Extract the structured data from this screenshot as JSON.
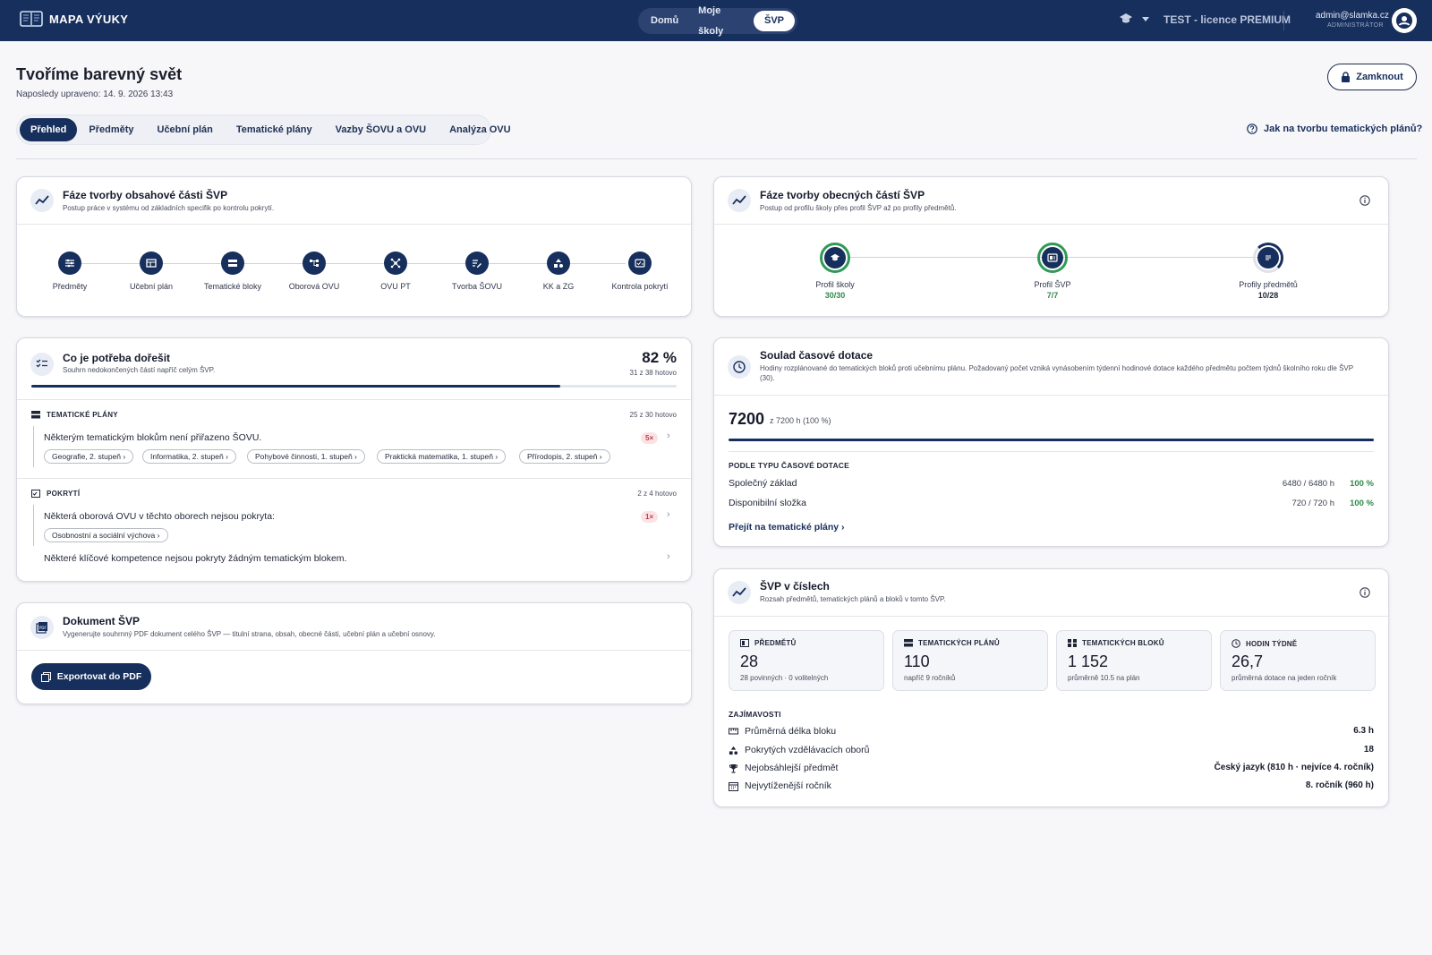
{
  "topbar": {
    "logo_text": "MAPA VÝUKY",
    "nav": [
      {
        "label": "Domů"
      },
      {
        "label": "Moje školy"
      },
      {
        "label": "ŠVP"
      }
    ],
    "license": "TEST - licence PREMIUM",
    "user_email": "admin@slamka.cz",
    "user_role": "ADMINISTRÁTOR"
  },
  "page": {
    "title": "Tvoříme barevný svět",
    "subtitle": "Naposledy upraveno: 14. 9. 2026 13:43",
    "lock_label": "Zamknout",
    "help_label": "Jak na tvorbu tematických plánů?"
  },
  "tabs": [
    {
      "label": "Přehled"
    },
    {
      "label": "Předměty"
    },
    {
      "label": "Učební plán"
    },
    {
      "label": "Tematické plány"
    },
    {
      "label": "Vazby ŠOVU a OVU"
    },
    {
      "label": "Analýza OVU"
    }
  ],
  "content_phases": {
    "title": "Fáze tvorby obsahové části ŠVP",
    "subtitle": "Postup práce v systému od základních specifik po kontrolu pokrytí.",
    "steps": [
      {
        "label": "Předměty"
      },
      {
        "label": "Učební plán"
      },
      {
        "label": "Tematické bloky"
      },
      {
        "label": "Oborová OVU"
      },
      {
        "label": "OVU PT"
      },
      {
        "label": "Tvorba ŠOVU"
      },
      {
        "label": "KK a ZG"
      },
      {
        "label": "Kontrola pokrytí"
      }
    ]
  },
  "general_phases": {
    "title": "Fáze tvorby obecných částí ŠVP",
    "subtitle": "Postup od profilu školy přes profil ŠVP až po profily předmětů.",
    "profiles": [
      {
        "label": "Profil školy",
        "value": "30/30",
        "fraction": 1.0
      },
      {
        "label": "Profil ŠVP",
        "value": "7/7",
        "fraction": 1.0
      },
      {
        "label": "Profily předmětů",
        "value": "10/28",
        "fraction": 0.357
      }
    ]
  },
  "todo": {
    "title": "Co je potřeba dořešit",
    "subtitle": "Souhrn nedokončených částí napříč celým ŠVP.",
    "percent": "82 %",
    "progress": 0.82,
    "done_text": "31 z 38 hotovo",
    "sections": [
      {
        "title": "TEMATICKÉ PLÁNY",
        "done": "25 z 30 hotovo",
        "items": [
          {
            "text": "Některým tematickým blokům není přiřazeno ŠOVU.",
            "count": "5×",
            "chips": [
              "Geografie, 2. stupeň",
              "Informatika, 2. stupeň",
              "Pohybové činnosti, 1. stupeň",
              "Praktická matematika, 1. stupeň",
              "Přírodopis, 2. stupeň"
            ]
          }
        ]
      },
      {
        "title": "POKRYTÍ",
        "done": "2 z 4 hotovo",
        "items": [
          {
            "text": "Některá oborová OVU v těchto oborech nejsou pokryta:",
            "count": "1×",
            "chips": [
              "Osobnostní a sociální výchova"
            ]
          },
          {
            "text": "Některé klíčové kompetence nejsou pokryty žádným tematickým blokem."
          }
        ]
      }
    ]
  },
  "document": {
    "title": "Dokument ŠVP",
    "subtitle": "Vygenerujte souhrnný PDF dokument celého ŠVP — titulní strana, obsah, obecné části, učební plán a učební osnovy.",
    "export_label": "Exportovat do PDF"
  },
  "time": {
    "title": "Soulad časové dotace",
    "subtitle": "Hodiny rozplánované do tematických bloků proti učebnímu plánu. Požadovaný počet vzniká vynásobením týdenní hodinové dotace každého předmětu počtem týdnů školního roku dle ŠVP (30).",
    "total": "7200",
    "total_sub": "z 7200 h (100 %)",
    "progress": 1.0,
    "by_type_label": "PODLE TYPU ČASOVÉ DOTACE",
    "rows": [
      {
        "label": "Společný základ",
        "value": "6480 / 6480 h",
        "pct": "100 %"
      },
      {
        "label": "Disponibilní složka",
        "value": "720 / 720 h",
        "pct": "100 %"
      }
    ],
    "link": "Přejít na tematické plány"
  },
  "numbers": {
    "title": "ŠVP v číslech",
    "subtitle": "Rozsah předmětů, tematických plánů a bloků v tomto ŠVP.",
    "stats": [
      {
        "label": "PŘEDMĚTŮ",
        "value": "28",
        "sub": "28 povinných · 0 volitelných",
        "icon": "subjects-icon"
      },
      {
        "label": "TEMATICKÝCH PLÁNŮ",
        "value": "110",
        "sub": "napříč 9 ročníků",
        "icon": "plans-icon"
      },
      {
        "label": "TEMATICKÝCH BLOKŮ",
        "value": "1 152",
        "sub": "průměrně 10.5 na plán",
        "icon": "blocks-icon"
      },
      {
        "label": "HODIN TÝDNĚ",
        "value": "26,7",
        "sub": "průměrná dotace na jeden ročník",
        "icon": "clock-icon"
      }
    ],
    "facts_label": "ZAJÍMAVOSTI",
    "facts": [
      {
        "label": "Průměrná délka bloku",
        "value": "6.3 h",
        "icon": "ruler-icon"
      },
      {
        "label": "Pokrytých vzdělávacích oborů",
        "value": "18",
        "icon": "shapes-icon"
      },
      {
        "label": "Nejobsáhlejší předmět",
        "value": "Český jazyk (810 h · nejvíce 4. ročník)",
        "icon": "trophy-icon"
      },
      {
        "label": "Nejvytíženější ročník",
        "value": "8. ročník (960 h)",
        "icon": "calendar-icon"
      }
    ]
  }
}
